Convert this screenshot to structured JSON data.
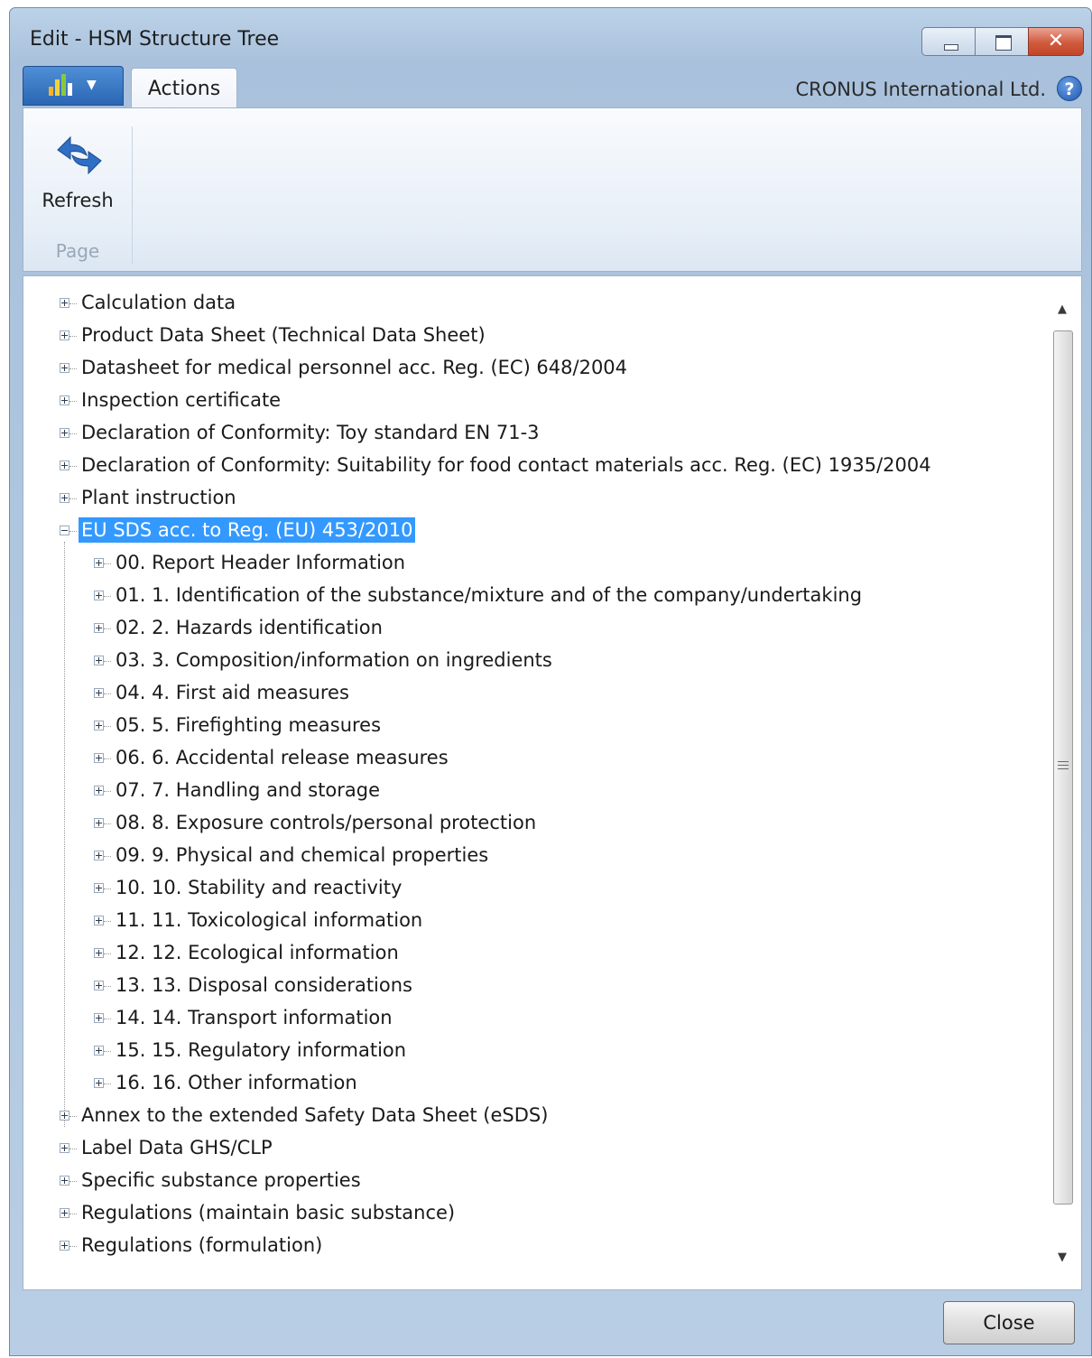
{
  "window": {
    "title": "Edit - HSM Structure Tree"
  },
  "ribbon": {
    "tabs": [
      {
        "label": "Actions"
      }
    ],
    "company": "CRONUS International Ltd.",
    "groups": [
      {
        "label": "Page",
        "buttons": [
          {
            "label": "Refresh",
            "icon": "refresh-icon"
          }
        ]
      }
    ]
  },
  "tree": {
    "nodes": [
      {
        "label": "Calculation data",
        "level": 0,
        "expanded": false
      },
      {
        "label": "Product Data Sheet (Technical Data Sheet)",
        "level": 0,
        "expanded": false
      },
      {
        "label": "Datasheet for medical personnel acc. Reg. (EC) 648/2004",
        "level": 0,
        "expanded": false
      },
      {
        "label": "Inspection certificate",
        "level": 0,
        "expanded": false
      },
      {
        "label": "Declaration of Conformity: Toy standard EN 71-3",
        "level": 0,
        "expanded": false
      },
      {
        "label": "Declaration of Conformity: Suitability for food contact materials acc. Reg. (EC) 1935/2004",
        "level": 0,
        "expanded": false
      },
      {
        "label": "Plant instruction",
        "level": 0,
        "expanded": false
      },
      {
        "label": "EU SDS acc. to Reg. (EU) 453/2010",
        "level": 0,
        "expanded": true,
        "selected": true
      },
      {
        "label": "00. Report Header Information",
        "level": 1,
        "expanded": false
      },
      {
        "label": "01. 1. Identification of the substance/mixture and of the company/undertaking",
        "level": 1,
        "expanded": false
      },
      {
        "label": "02. 2. Hazards identification",
        "level": 1,
        "expanded": false
      },
      {
        "label": "03. 3. Composition/information on ingredients",
        "level": 1,
        "expanded": false
      },
      {
        "label": "04. 4. First aid measures",
        "level": 1,
        "expanded": false
      },
      {
        "label": "05. 5. Firefighting measures",
        "level": 1,
        "expanded": false
      },
      {
        "label": "06. 6. Accidental release measures",
        "level": 1,
        "expanded": false
      },
      {
        "label": "07. 7. Handling and storage",
        "level": 1,
        "expanded": false
      },
      {
        "label": "08. 8. Exposure controls/personal protection",
        "level": 1,
        "expanded": false
      },
      {
        "label": "09. 9. Physical and chemical properties",
        "level": 1,
        "expanded": false
      },
      {
        "label": "10. 10. Stability and reactivity",
        "level": 1,
        "expanded": false
      },
      {
        "label": "11. 11. Toxicological information",
        "level": 1,
        "expanded": false
      },
      {
        "label": "12. 12. Ecological information",
        "level": 1,
        "expanded": false
      },
      {
        "label": "13. 13. Disposal considerations",
        "level": 1,
        "expanded": false
      },
      {
        "label": "14. 14. Transport information",
        "level": 1,
        "expanded": false
      },
      {
        "label": "15. 15. Regulatory information",
        "level": 1,
        "expanded": false
      },
      {
        "label": "16. 16. Other information",
        "level": 1,
        "expanded": false
      },
      {
        "label": "Annex to the extended Safety Data Sheet (eSDS)",
        "level": 0,
        "expanded": false
      },
      {
        "label": "Label Data GHS/CLP",
        "level": 0,
        "expanded": false
      },
      {
        "label": "Specific substance properties",
        "level": 0,
        "expanded": false
      },
      {
        "label": "Regulations (maintain basic substance)",
        "level": 0,
        "expanded": false
      },
      {
        "label": "Regulations (formulation)",
        "level": 0,
        "expanded": false
      }
    ]
  },
  "footer": {
    "close_label": "Close"
  },
  "colors": {
    "selection": "#3399ff",
    "app_button": "#2a66b4",
    "close_window": "#d05a3d"
  }
}
